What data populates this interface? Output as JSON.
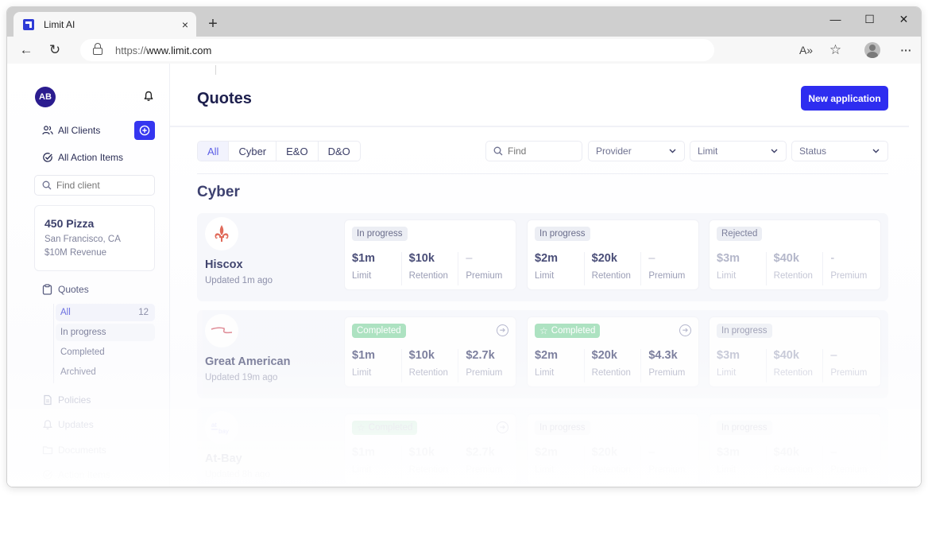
{
  "browser": {
    "tab_title": "Limit AI",
    "tab_close": "×",
    "new_tab": "+",
    "url_protocol": "https://",
    "url_host": "www.limit.com",
    "controls": {
      "minimize": "—",
      "maximize": "☐",
      "close": "✕"
    },
    "nav": {
      "back": "←",
      "reload": "↻",
      "read_aloud": "A»",
      "favorite": "☆",
      "more": "···"
    }
  },
  "sidebar": {
    "avatar_initials": "AB",
    "all_clients": "All Clients",
    "all_action_items": "All Action Items",
    "find_client_placeholder": "Find client",
    "client": {
      "name": "450 Pizza",
      "location": "San Francisco, CA",
      "revenue": "$10M Revenue"
    },
    "quotes_label": "Quotes",
    "quotes_sub": [
      {
        "label": "All",
        "count": "12"
      },
      {
        "label": "In progress",
        "count": ""
      },
      {
        "label": "Completed",
        "count": ""
      },
      {
        "label": "Archived",
        "count": ""
      }
    ],
    "sections": [
      {
        "label": "Policies"
      },
      {
        "label": "Updates"
      },
      {
        "label": "Documents"
      },
      {
        "label": "Action Items"
      }
    ]
  },
  "main": {
    "title": "Quotes",
    "new_application": "New application",
    "tabs": [
      "All",
      "Cyber",
      "E&O",
      "D&O"
    ],
    "active_tab": "All",
    "find_placeholder": "Find",
    "filters": {
      "provider": "Provider",
      "limit": "Limit",
      "status": "Status"
    },
    "section_title": "Cyber",
    "providers": [
      {
        "name": "Hiscox",
        "updated": "Updated 1m ago",
        "logo": "fleur-de-lis",
        "quotes": [
          {
            "status": "In progress",
            "starred": false,
            "has_arrow": false,
            "limit": "$1m",
            "retention": "$10k",
            "premium": "–"
          },
          {
            "status": "In progress",
            "starred": false,
            "has_arrow": false,
            "limit": "$2m",
            "retention": "$20k",
            "premium": "–"
          },
          {
            "status": "Rejected",
            "starred": false,
            "has_arrow": false,
            "limit": "$3m",
            "retention": "$40k",
            "premium": "-"
          }
        ]
      },
      {
        "name": "Great American",
        "updated": "Updated 19m ago",
        "logo": "swoosh",
        "quotes": [
          {
            "status": "Completed",
            "starred": false,
            "has_arrow": true,
            "limit": "$1m",
            "retention": "$10k",
            "premium": "$2.7k"
          },
          {
            "status": "Completed",
            "starred": true,
            "has_arrow": true,
            "limit": "$2m",
            "retention": "$20k",
            "premium": "$4.3k"
          },
          {
            "status": "In progress",
            "starred": false,
            "has_arrow": false,
            "limit": "$3m",
            "retention": "$40k",
            "premium": "–"
          }
        ]
      },
      {
        "name": "At-Bay",
        "updated": "Updated 8h ago",
        "logo": "at-bay",
        "quotes": [
          {
            "status": "Completed",
            "starred": true,
            "has_arrow": true,
            "limit": "$1m",
            "retention": "$10k",
            "premium": "$2.7k"
          },
          {
            "status": "In progress",
            "starred": false,
            "has_arrow": false,
            "limit": "$2m",
            "retention": "$20k",
            "premium": "–"
          },
          {
            "status": "In progress",
            "starred": false,
            "has_arrow": false,
            "limit": "$3m",
            "retention": "$40k",
            "premium": "–"
          }
        ]
      }
    ],
    "metric_labels": {
      "limit": "Limit",
      "retention": "Retention",
      "premium": "Premium"
    }
  },
  "colors": {
    "primary": "#2e2df0",
    "avatar": "#2b1c8f",
    "completed_badge": "#8fd8aa",
    "hiscox_logo": "#e06a5a"
  }
}
